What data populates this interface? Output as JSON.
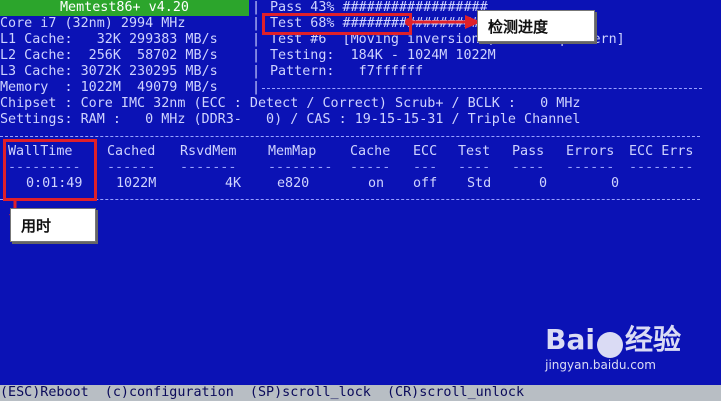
{
  "title": "Memtest86+ v4.20",
  "left_info": [
    "Core i7 (32nm) 2994 MHz",
    "L1 Cache:   32K 299383 MB/s",
    "L2 Cache:  256K  58702 MB/s",
    "L3 Cache: 3072K 230295 MB/s",
    "Memory  : 1022M  49079 MB/s"
  ],
  "right_info": [
    "Pass 43% ##################",
    "Test 68% ###########################",
    "Test #6  [Moving inversions, 32 bit pattern]",
    "Testing:  184K - 1024M 1022M",
    "Pattern:   f7ffffff"
  ],
  "chipset_line": "Chipset : Core IMC 32nm (ECC : Detect / Correct) Scrub+ / BCLK :   0 MHz",
  "settings_line": "Settings: RAM :   0 MHz (DDR3-   0) / CAS : 19-15-15-31 / Triple Channel",
  "table": {
    "headers": [
      "WallTime",
      "Cached",
      "RsvdMem",
      "MemMap",
      "Cache",
      "ECC",
      "Test",
      "Pass",
      "Errors",
      "ECC Errs"
    ],
    "underlines": [
      "---------",
      "------",
      "-------",
      "--------",
      "-----",
      "---",
      "----",
      "----",
      "------",
      "--------"
    ],
    "values": [
      "0:01:49",
      "1022M",
      "4K",
      "e820",
      "on",
      "off",
      "Std",
      "0",
      "0",
      ""
    ]
  },
  "annotations": {
    "progress_label": "检测进度",
    "time_label": "用时"
  },
  "bottom_bar": "(ESC)Reboot  (c)configuration  (SP)scroll_lock  (CR)scroll_unlock",
  "watermark": {
    "brand": "Bai",
    "brand2": "经验",
    "url": "jingyan.baidu.com"
  }
}
